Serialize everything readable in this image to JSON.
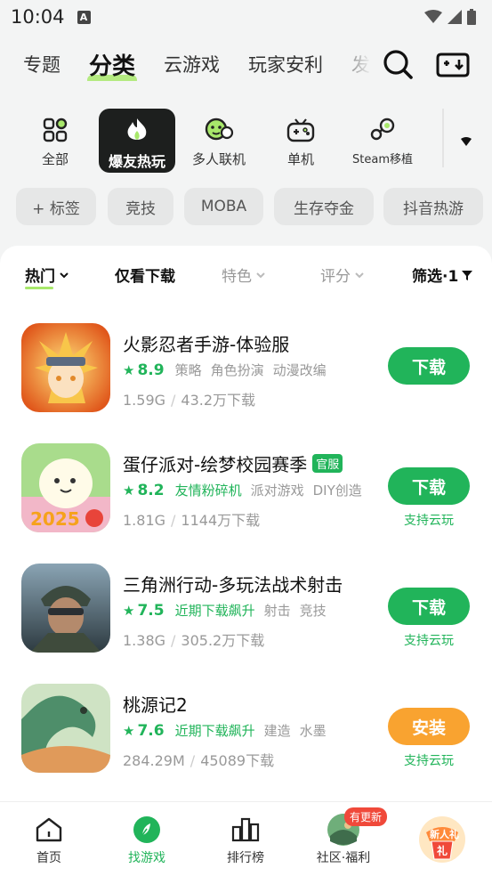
{
  "status": {
    "time": "10:04",
    "a_icon": "A"
  },
  "topnav": {
    "tabs": [
      "专题",
      "分类",
      "云游戏",
      "玩家安利",
      "发"
    ],
    "active_tab": "分类",
    "icons": [
      "search-icon",
      "download-manager-icon"
    ]
  },
  "categories": [
    {
      "label": "全部",
      "icon": "grid-icon"
    },
    {
      "label": "爆友热玩",
      "icon": "flame-icon"
    },
    {
      "label": "多人联机",
      "icon": "multiplayer-icon"
    },
    {
      "label": "单机",
      "icon": "gamepad-icon"
    },
    {
      "label": "Steam移植",
      "icon": "steam-icon"
    }
  ],
  "chips": [
    "+ 标签",
    "竞技",
    "MOBA",
    "生存夺金",
    "抖音热游"
  ],
  "sortbar": {
    "hot": "热门",
    "download_only": "仅看下载",
    "feature": "特色",
    "rating": "评分",
    "filter": "筛选·1"
  },
  "games": [
    {
      "name": "火影忍者手游-体验服",
      "official": "",
      "score": "8.9",
      "tag_green": "",
      "tags": [
        "策略",
        "角色扮演",
        "动漫改编"
      ],
      "size": "1.59G",
      "downloads": "43.2万下载",
      "button": "下载",
      "cloud": ""
    },
    {
      "name": "蛋仔派对-绘梦校园赛季",
      "official": "官服",
      "score": "8.2",
      "tag_green": "友情粉碎机",
      "tags": [
        "派对游戏",
        "DIY创造"
      ],
      "size": "1.81G",
      "downloads": "1144万下载",
      "button": "下载",
      "cloud": "支持云玩"
    },
    {
      "name": "三角洲行动-多玩法战术射击",
      "official": "",
      "score": "7.5",
      "tag_green": "近期下载飙升",
      "tags": [
        "射击",
        "竞技"
      ],
      "size": "1.38G",
      "downloads": "305.2万下载",
      "button": "下载",
      "cloud": "支持云玩"
    },
    {
      "name": "桃源记2",
      "official": "",
      "score": "7.6",
      "tag_green": "近期下载飙升",
      "tags": [
        "建造",
        "水墨"
      ],
      "size": "284.29M",
      "downloads": "45089下载",
      "button": "安装",
      "cloud": "支持云玩"
    }
  ],
  "bottomnav": {
    "items": [
      "首页",
      "找游戏",
      "排行榜",
      "社区·福利",
      ""
    ],
    "active": "找游戏",
    "community_badge": "有更新",
    "gift_label": "新人礼"
  },
  "colors": {
    "accent": "#21b45a",
    "highlight": "#a8e86b",
    "install": "#f9a330"
  }
}
